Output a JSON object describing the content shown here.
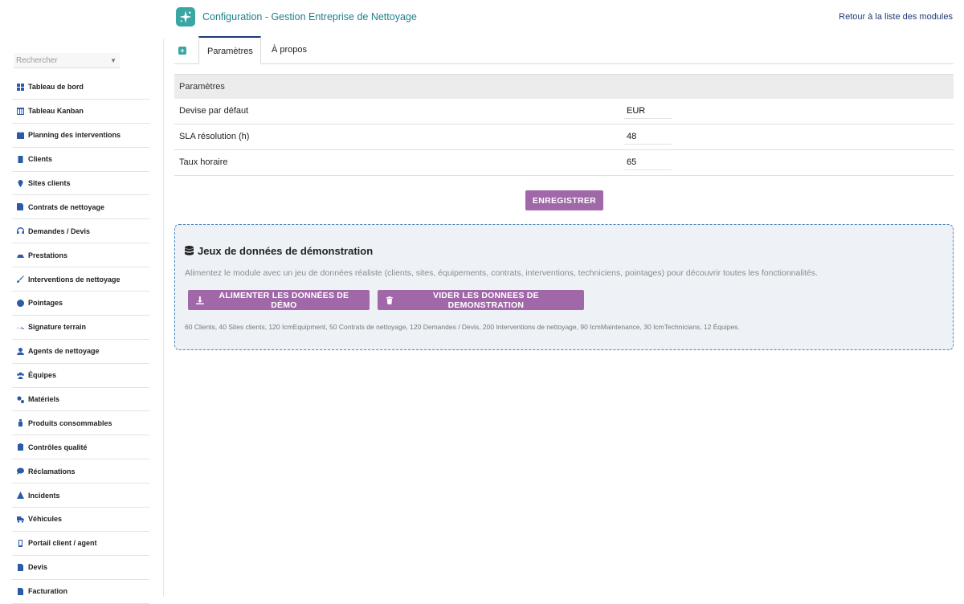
{
  "header": {
    "title": "Configuration - Gestion Entreprise de Nettoyage",
    "back_link": "Retour à la liste des modules",
    "logo_icon": "sparkle-icon"
  },
  "sidebar": {
    "search_placeholder": "Rechercher",
    "items": [
      {
        "label": "Tableau de bord",
        "icon": "dashboard-icon"
      },
      {
        "label": "Tableau Kanban",
        "icon": "kanban-icon"
      },
      {
        "label": "Planning des interventions",
        "icon": "calendar-icon"
      },
      {
        "label": "Clients",
        "icon": "building-icon"
      },
      {
        "label": "Sites clients",
        "icon": "map-pin-icon"
      },
      {
        "label": "Contrats de nettoyage",
        "icon": "contract-icon"
      },
      {
        "label": "Demandes / Devis",
        "icon": "headset-icon"
      },
      {
        "label": "Prestations",
        "icon": "broom-icon"
      },
      {
        "label": "Interventions de nettoyage",
        "icon": "brush-icon"
      },
      {
        "label": "Pointages",
        "icon": "clock-icon"
      },
      {
        "label": "Signature terrain",
        "icon": "signature-icon"
      },
      {
        "label": "Agents de nettoyage",
        "icon": "user-icon"
      },
      {
        "label": "Équipes",
        "icon": "users-icon"
      },
      {
        "label": "Matériels",
        "icon": "cogs-icon"
      },
      {
        "label": "Produits consommables",
        "icon": "spray-icon"
      },
      {
        "label": "Contrôles qualité",
        "icon": "clipboard-check-icon"
      },
      {
        "label": "Réclamations",
        "icon": "comment-icon"
      },
      {
        "label": "Incidents",
        "icon": "warning-icon"
      },
      {
        "label": "Véhicules",
        "icon": "truck-icon"
      },
      {
        "label": "Portail client / agent",
        "icon": "mobile-icon"
      },
      {
        "label": "Devis",
        "icon": "file-icon"
      },
      {
        "label": "Facturation",
        "icon": "invoice-icon"
      }
    ]
  },
  "tabs": [
    {
      "label": "Paramètres",
      "active": true
    },
    {
      "label": "À propos",
      "active": false
    }
  ],
  "params": {
    "section_title": "Paramètres",
    "rows": [
      {
        "label": "Devise par défaut",
        "value": "EUR"
      },
      {
        "label": "SLA résolution (h)",
        "value": "48"
      },
      {
        "label": "Taux horaire",
        "value": "65"
      }
    ],
    "save_label": "ENREGISTRER"
  },
  "demo": {
    "title": "Jeux de données de démonstration",
    "description": "Alimentez le module avec un jeu de données réaliste (clients, sites, équipements, contrats, interventions, techniciens, pointages) pour découvrir toutes les fonctionnalités.",
    "feed_label": "ALIMENTER LES DONNÉES DE DÉMO",
    "clear_label": "VIDER LES DONNEES DE DEMONSTRATION",
    "stats": "60 Clients, 40 Sites clients, 120 IcmEquipment, 50 Contrats de nettoyage, 120 Demandes / Devis, 200 Interventions de nettoyage, 90 IcmMaintenance, 30 IcmTechnicians, 12 Équipes."
  },
  "colors": {
    "accent_button": "#a068a8",
    "title_teal": "#1f7f8a",
    "menu_icon": "#2b5aa8",
    "demo_border": "#4a84b8"
  }
}
